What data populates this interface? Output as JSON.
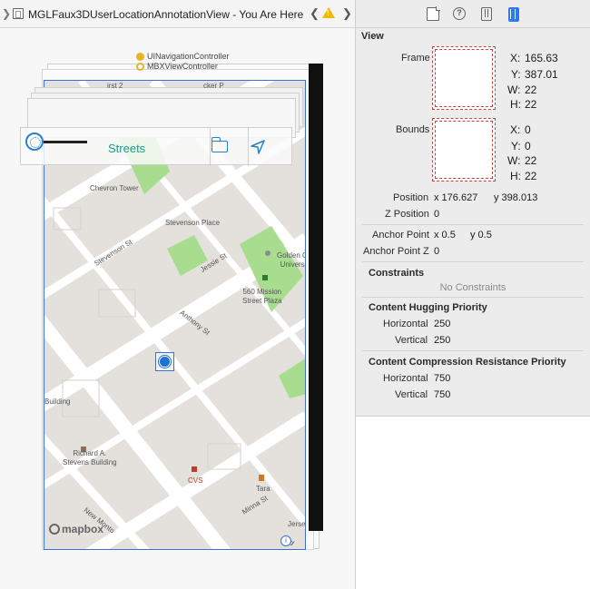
{
  "jumpbar": {
    "title": "MGLFaux3DUserLocationAnnotationView - You Are Here",
    "prev_glyph": "❮",
    "next_glyph": "❯",
    "breadcrumb_glyph": "❯",
    "warning_icon": "warning-triangle-icon"
  },
  "hierarchy": {
    "nav_controller": "UINavigationController",
    "view_controller": "MBXViewController",
    "toolbar_title": "Streets",
    "map_labels": {
      "chevron_tower": "Chevron Tower",
      "stevenson_place": "Stevenson Place",
      "golden_gate": "Golden G\nUnivers",
      "mission_plaza": "560 Mission\nStreet Plaza",
      "building": "Building",
      "richard": "Richard A.\nStevens Building",
      "cvs": "CVS",
      "tara": "Tara",
      "jersey": "Jerse",
      "stevenson_st": "Stevenson St",
      "jessie_st": "Jessie St",
      "anthony_st": "Anthony St",
      "new_montgomery": "New Monto",
      "minna_st": "Minna St",
      "second_st": "2nd",
      "first_st": "irst 2",
      "packer": "cker P"
    },
    "mapbox_logo": "mapbox",
    "info_glyph": "i"
  },
  "inspector": {
    "tabs": [
      "file-inspector-icon",
      "quick-help-icon",
      "identity-inspector-icon",
      "size-inspector-icon"
    ],
    "section": "View",
    "frame_label": "Frame",
    "frame": {
      "x_label": "X:",
      "x": "165.63",
      "y_label": "Y:",
      "y": "387.01",
      "w_label": "W:",
      "w": "22",
      "h_label": "H:",
      "h": "22"
    },
    "bounds_label": "Bounds",
    "bounds": {
      "x_label": "X:",
      "x": "0",
      "y_label": "Y:",
      "y": "0",
      "w_label": "W:",
      "w": "22",
      "h_label": "H:",
      "h": "22"
    },
    "position_label": "Position",
    "position_x": "x  176.627",
    "position_y": "y  398.013",
    "z_position_label": "Z Position",
    "z_position": "0",
    "anchor_point_label": "Anchor Point",
    "anchor_x": "x  0.5",
    "anchor_y": "y  0.5",
    "anchor_z_label": "Anchor Point Z",
    "anchor_z": "0",
    "constraints_title": "Constraints",
    "constraints_empty": "No Constraints",
    "hugging_title": "Content Hugging Priority",
    "hugging_h_label": "Horizontal",
    "hugging_h": "250",
    "hugging_v_label": "Vertical",
    "hugging_v": "250",
    "compression_title": "Content Compression Resistance Priority",
    "compression_h_label": "Horizontal",
    "compression_h": "750",
    "compression_v_label": "Vertical",
    "compression_v": "750"
  },
  "colors": {
    "accent_blue": "#2f7ae5",
    "selection_outline": "#3b6fd1",
    "frame_dash": "#c94040",
    "park_green": "#a8dc8f",
    "streets_teal": "#1a9c8f",
    "warning_yellow": "#f5b800"
  }
}
